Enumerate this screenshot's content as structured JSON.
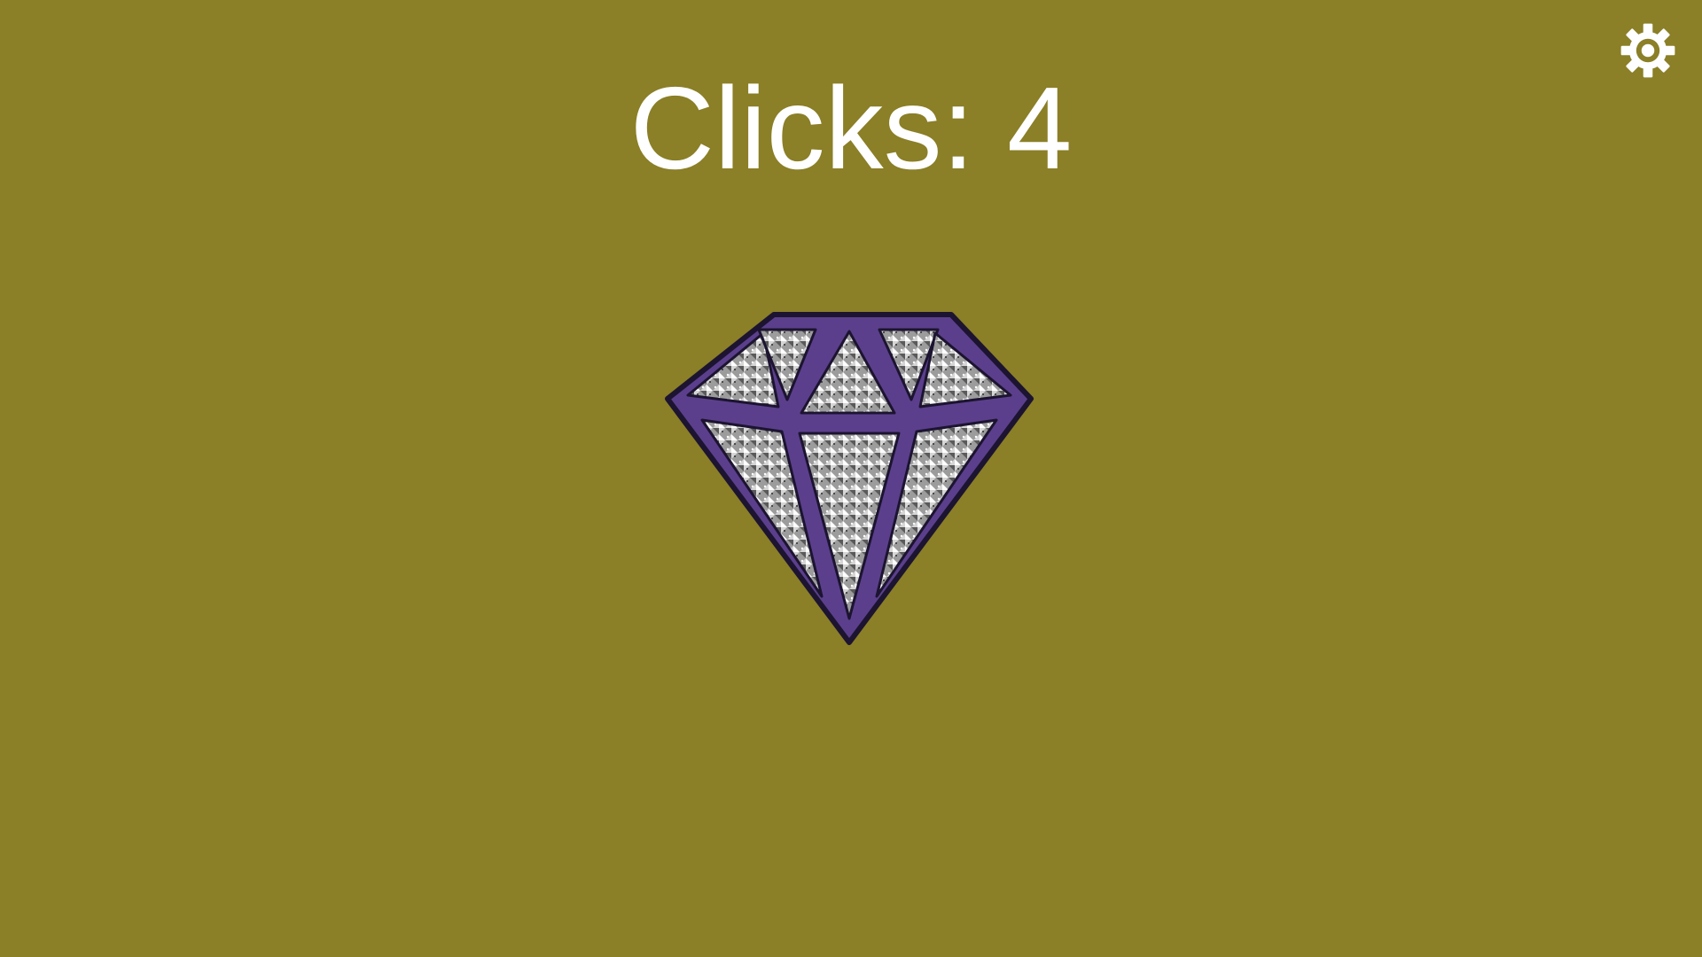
{
  "game": {
    "clicks_label": "Clicks: 4",
    "clicks": 4
  },
  "settings": {
    "icon": "gear-icon"
  },
  "diamond": {
    "icon": "diamond-icon",
    "outline_color": "#5b3f8c",
    "border_color": "#1c1430",
    "facet_color": "#b8b8b8"
  },
  "colors": {
    "background": "#8b7f27",
    "text": "#ffffff"
  }
}
